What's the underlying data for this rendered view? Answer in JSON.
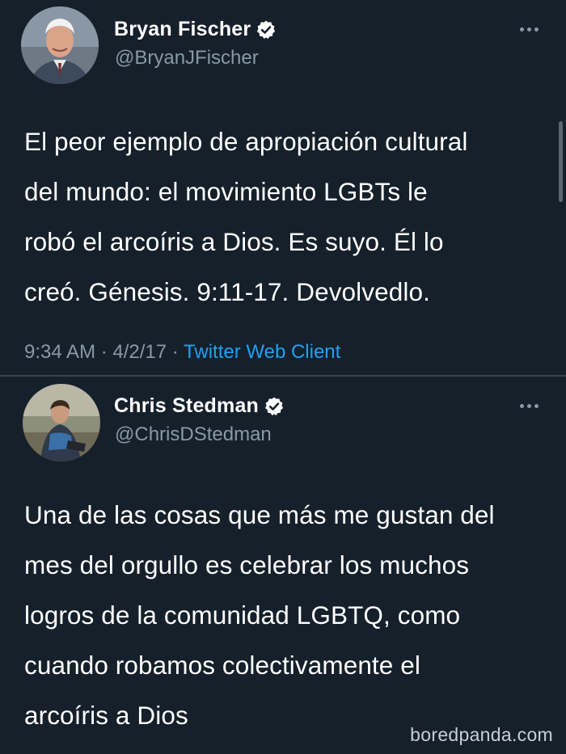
{
  "tweets": [
    {
      "display_name": "Bryan Fischer",
      "handle": "@BryanJFischer",
      "verified_icon": "verified-badge-icon",
      "text": "El peor ejemplo de apropiación cultural\ndel mundo: el movimiento LGBTs le\nrobó el arcoíris a Dios. Es suyo. Él lo\ncreó. Génesis. 9:11-17. Devolvedlo.",
      "time": "9:34 AM",
      "separator": " · ",
      "date": "4/2/17",
      "client": "Twitter Web Client"
    },
    {
      "display_name": "Chris Stedman",
      "handle": "@ChrisDStedman",
      "verified_icon": "verified-badge-icon",
      "text": "Una de las cosas que más me gustan del\nmes del orgullo es celebrar los muchos\nlogros de la comunidad LGBTQ, como\ncuando robamos colectivamente el\narcoíris a Dios"
    }
  ],
  "watermark": "boredpanda.com",
  "colors": {
    "background": "#15202b",
    "text": "#ffffff",
    "secondary_text": "#8899a6",
    "link": "#1da1f2",
    "divider": "#38444d"
  }
}
